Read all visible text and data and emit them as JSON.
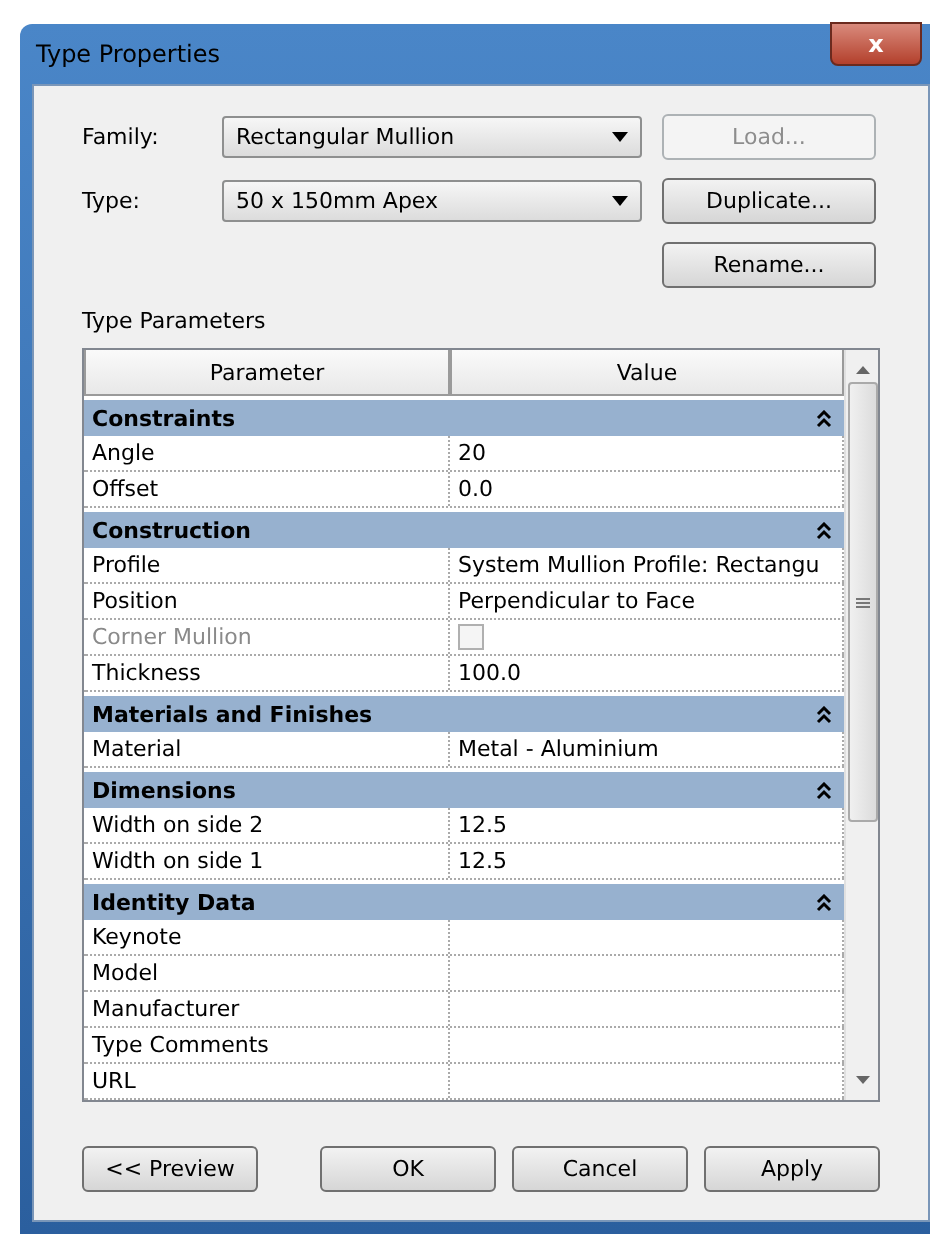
{
  "window": {
    "title": "Type Properties",
    "close": "x"
  },
  "fields": [
    {
      "label": "Family:",
      "value": "Rectangular Mullion"
    },
    {
      "label": "Type:",
      "value": "50 x 150mm Apex"
    }
  ],
  "side_buttons": [
    {
      "label": "Load...",
      "disabled": true
    },
    {
      "label": "Duplicate...",
      "disabled": false
    },
    {
      "label": "Rename...",
      "disabled": false
    }
  ],
  "section_title": "Type Parameters",
  "table": {
    "columns": [
      "Parameter",
      "Value"
    ],
    "groups": [
      {
        "name": "Constraints",
        "expanded": true,
        "rows": [
          {
            "kind": "text",
            "parameter": "Angle",
            "value": "20",
            "disabled": false
          },
          {
            "kind": "text",
            "parameter": "Offset",
            "value": "0.0",
            "disabled": false
          }
        ]
      },
      {
        "name": "Construction",
        "expanded": true,
        "rows": [
          {
            "kind": "text",
            "parameter": "Profile",
            "value": "System Mullion Profile: Rectangu",
            "disabled": false
          },
          {
            "kind": "text",
            "parameter": "Position",
            "value": "Perpendicular to Face",
            "disabled": false
          },
          {
            "kind": "checkbox",
            "parameter": "Corner Mullion",
            "checked": false,
            "disabled": true
          },
          {
            "kind": "text",
            "parameter": "Thickness",
            "value": "100.0",
            "disabled": false
          }
        ]
      },
      {
        "name": "Materials and Finishes",
        "expanded": true,
        "rows": [
          {
            "kind": "text",
            "parameter": "Material",
            "value": "Metal - Aluminium",
            "disabled": false
          }
        ]
      },
      {
        "name": "Dimensions",
        "expanded": true,
        "rows": [
          {
            "kind": "text",
            "parameter": "Width on side 2",
            "value": "12.5",
            "disabled": false
          },
          {
            "kind": "text",
            "parameter": "Width on side 1",
            "value": "12.5",
            "disabled": false
          }
        ]
      },
      {
        "name": "Identity Data",
        "expanded": true,
        "rows": [
          {
            "kind": "text",
            "parameter": "Keynote",
            "disabled": false
          },
          {
            "kind": "text",
            "parameter": "Model",
            "disabled": false
          },
          {
            "kind": "text",
            "parameter": "Manufacturer",
            "disabled": false
          },
          {
            "kind": "text",
            "parameter": "Type Comments",
            "disabled": false
          },
          {
            "kind": "text",
            "parameter": "URL",
            "disabled": false
          }
        ]
      }
    ]
  },
  "buttons": [
    {
      "label": "<< Preview"
    },
    {
      "label": "OK"
    },
    {
      "label": "Cancel"
    },
    {
      "label": "Apply"
    }
  ]
}
